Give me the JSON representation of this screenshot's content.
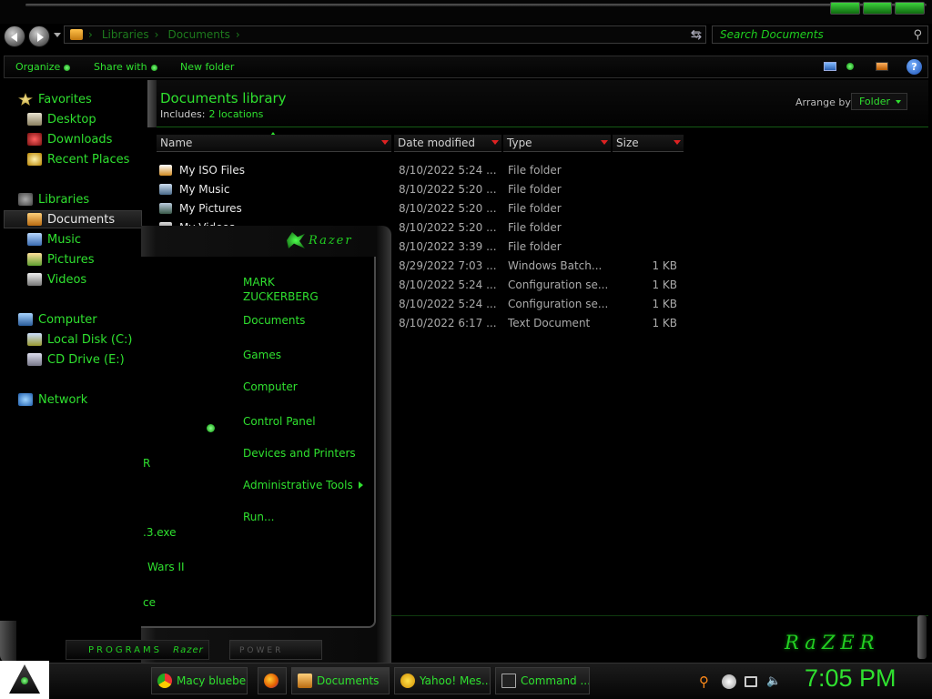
{
  "address": {
    "crumbs": [
      "Libraries",
      "Documents"
    ]
  },
  "search": {
    "placeholder": "Search Documents"
  },
  "command_bar": {
    "organize": "Organize",
    "share_with": "Share with",
    "new_folder": "New folder"
  },
  "nav": {
    "favorites": "Favorites",
    "desktop": "Desktop",
    "downloads": "Downloads",
    "recent_places": "Recent Places",
    "libraries": "Libraries",
    "documents": "Documents",
    "music": "Music",
    "pictures": "Pictures",
    "videos": "Videos",
    "computer": "Computer",
    "local_disk": "Local Disk (C:)",
    "cd_drive": "CD Drive (E:)",
    "network": "Network"
  },
  "library": {
    "title": "Documents library",
    "includes_label": "Includes:",
    "includes_link": "2 locations",
    "arrange_label": "Arrange by:",
    "arrange_value": "Folder"
  },
  "columns": {
    "name": "Name",
    "date": "Date modified",
    "type": "Type",
    "size": "Size"
  },
  "files": [
    {
      "name": "My ISO Files",
      "date": "8/10/2022 5:24 ...",
      "type": "File folder",
      "size": ""
    },
    {
      "name": "My Music",
      "date": "8/10/2022 5:20 ...",
      "type": "File folder",
      "size": ""
    },
    {
      "name": "My Pictures",
      "date": "8/10/2022 5:20 ...",
      "type": "File folder",
      "size": ""
    },
    {
      "name": "My Videos",
      "date": "8/10/2022 5:20 ...",
      "type": "File folder",
      "size": ""
    },
    {
      "name": "",
      "date": "8/10/2022 3:39 ...",
      "type": "File folder",
      "size": ""
    },
    {
      "name": "",
      "date": "8/29/2022 7:03 ...",
      "type": "Windows Batch...",
      "size": "1 KB"
    },
    {
      "name": "",
      "date": "8/10/2022 5:24 ...",
      "type": "Configuration se...",
      "size": "1 KB"
    },
    {
      "name": "",
      "date": "8/10/2022 5:24 ...",
      "type": "Configuration se...",
      "size": "1 KB"
    },
    {
      "name": "",
      "date": "8/10/2022 6:17 ...",
      "type": "Text Document",
      "size": "1 KB"
    }
  ],
  "start_menu": {
    "logo": "Razer",
    "user": "MARK\nZUCKERBERG",
    "documents": "Documents",
    "games": "Games",
    "computer": "Computer",
    "control_panel": "Control Panel",
    "devices": "Devices and Printers",
    "admin_tools": "Administrative Tools",
    "run": "Run...",
    "recent_1": "R",
    "recent_2": ".3.exe",
    "recent_3": "Wars II",
    "recent_4": "ce",
    "programs": "PROGRAMS",
    "programs_brand": "Razer",
    "power": "POWER"
  },
  "brand": "RaZER",
  "taskbar": {
    "items": [
      "Macy bluebe...",
      "",
      "Documents",
      "Yahoo! Mes...",
      "Command ..."
    ],
    "clock": "7:05 PM"
  },
  "colors": {
    "accent": "#2fe02f",
    "background": "#000000",
    "selection": "#2a2a2a"
  }
}
